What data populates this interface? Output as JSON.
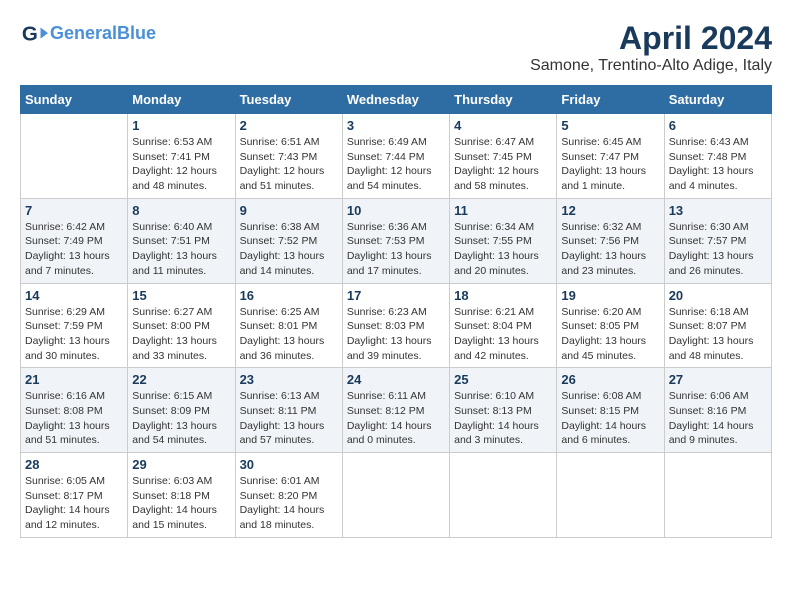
{
  "app": {
    "name": "GeneralBlue",
    "logo_line1": "General",
    "logo_line2": "Blue"
  },
  "title": "April 2024",
  "subtitle": "Samone, Trentino-Alto Adige, Italy",
  "colors": {
    "header_bg": "#2e6da4",
    "header_text": "#ffffff",
    "accent": "#1a3a5c"
  },
  "days_of_week": [
    "Sunday",
    "Monday",
    "Tuesday",
    "Wednesday",
    "Thursday",
    "Friday",
    "Saturday"
  ],
  "weeks": [
    {
      "cells": [
        {
          "day": "",
          "content": ""
        },
        {
          "day": "1",
          "content": "Sunrise: 6:53 AM\nSunset: 7:41 PM\nDaylight: 12 hours\nand 48 minutes."
        },
        {
          "day": "2",
          "content": "Sunrise: 6:51 AM\nSunset: 7:43 PM\nDaylight: 12 hours\nand 51 minutes."
        },
        {
          "day": "3",
          "content": "Sunrise: 6:49 AM\nSunset: 7:44 PM\nDaylight: 12 hours\nand 54 minutes."
        },
        {
          "day": "4",
          "content": "Sunrise: 6:47 AM\nSunset: 7:45 PM\nDaylight: 12 hours\nand 58 minutes."
        },
        {
          "day": "5",
          "content": "Sunrise: 6:45 AM\nSunset: 7:47 PM\nDaylight: 13 hours\nand 1 minute."
        },
        {
          "day": "6",
          "content": "Sunrise: 6:43 AM\nSunset: 7:48 PM\nDaylight: 13 hours\nand 4 minutes."
        }
      ]
    },
    {
      "cells": [
        {
          "day": "7",
          "content": "Sunrise: 6:42 AM\nSunset: 7:49 PM\nDaylight: 13 hours\nand 7 minutes."
        },
        {
          "day": "8",
          "content": "Sunrise: 6:40 AM\nSunset: 7:51 PM\nDaylight: 13 hours\nand 11 minutes."
        },
        {
          "day": "9",
          "content": "Sunrise: 6:38 AM\nSunset: 7:52 PM\nDaylight: 13 hours\nand 14 minutes."
        },
        {
          "day": "10",
          "content": "Sunrise: 6:36 AM\nSunset: 7:53 PM\nDaylight: 13 hours\nand 17 minutes."
        },
        {
          "day": "11",
          "content": "Sunrise: 6:34 AM\nSunset: 7:55 PM\nDaylight: 13 hours\nand 20 minutes."
        },
        {
          "day": "12",
          "content": "Sunrise: 6:32 AM\nSunset: 7:56 PM\nDaylight: 13 hours\nand 23 minutes."
        },
        {
          "day": "13",
          "content": "Sunrise: 6:30 AM\nSunset: 7:57 PM\nDaylight: 13 hours\nand 26 minutes."
        }
      ]
    },
    {
      "cells": [
        {
          "day": "14",
          "content": "Sunrise: 6:29 AM\nSunset: 7:59 PM\nDaylight: 13 hours\nand 30 minutes."
        },
        {
          "day": "15",
          "content": "Sunrise: 6:27 AM\nSunset: 8:00 PM\nDaylight: 13 hours\nand 33 minutes."
        },
        {
          "day": "16",
          "content": "Sunrise: 6:25 AM\nSunset: 8:01 PM\nDaylight: 13 hours\nand 36 minutes."
        },
        {
          "day": "17",
          "content": "Sunrise: 6:23 AM\nSunset: 8:03 PM\nDaylight: 13 hours\nand 39 minutes."
        },
        {
          "day": "18",
          "content": "Sunrise: 6:21 AM\nSunset: 8:04 PM\nDaylight: 13 hours\nand 42 minutes."
        },
        {
          "day": "19",
          "content": "Sunrise: 6:20 AM\nSunset: 8:05 PM\nDaylight: 13 hours\nand 45 minutes."
        },
        {
          "day": "20",
          "content": "Sunrise: 6:18 AM\nSunset: 8:07 PM\nDaylight: 13 hours\nand 48 minutes."
        }
      ]
    },
    {
      "cells": [
        {
          "day": "21",
          "content": "Sunrise: 6:16 AM\nSunset: 8:08 PM\nDaylight: 13 hours\nand 51 minutes."
        },
        {
          "day": "22",
          "content": "Sunrise: 6:15 AM\nSunset: 8:09 PM\nDaylight: 13 hours\nand 54 minutes."
        },
        {
          "day": "23",
          "content": "Sunrise: 6:13 AM\nSunset: 8:11 PM\nDaylight: 13 hours\nand 57 minutes."
        },
        {
          "day": "24",
          "content": "Sunrise: 6:11 AM\nSunset: 8:12 PM\nDaylight: 14 hours\nand 0 minutes."
        },
        {
          "day": "25",
          "content": "Sunrise: 6:10 AM\nSunset: 8:13 PM\nDaylight: 14 hours\nand 3 minutes."
        },
        {
          "day": "26",
          "content": "Sunrise: 6:08 AM\nSunset: 8:15 PM\nDaylight: 14 hours\nand 6 minutes."
        },
        {
          "day": "27",
          "content": "Sunrise: 6:06 AM\nSunset: 8:16 PM\nDaylight: 14 hours\nand 9 minutes."
        }
      ]
    },
    {
      "cells": [
        {
          "day": "28",
          "content": "Sunrise: 6:05 AM\nSunset: 8:17 PM\nDaylight: 14 hours\nand 12 minutes."
        },
        {
          "day": "29",
          "content": "Sunrise: 6:03 AM\nSunset: 8:18 PM\nDaylight: 14 hours\nand 15 minutes."
        },
        {
          "day": "30",
          "content": "Sunrise: 6:01 AM\nSunset: 8:20 PM\nDaylight: 14 hours\nand 18 minutes."
        },
        {
          "day": "",
          "content": ""
        },
        {
          "day": "",
          "content": ""
        },
        {
          "day": "",
          "content": ""
        },
        {
          "day": "",
          "content": ""
        }
      ]
    }
  ]
}
